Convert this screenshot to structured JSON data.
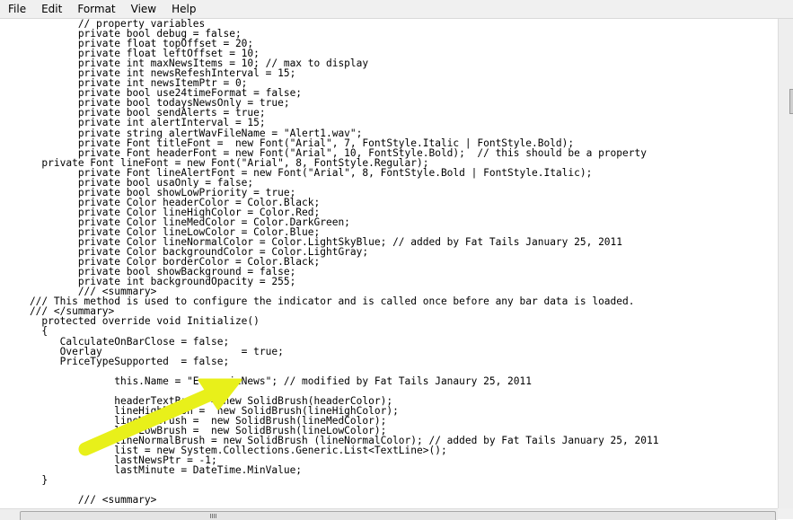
{
  "menu": {
    "items": [
      "File",
      "Edit",
      "Format",
      "View",
      "Help"
    ]
  },
  "editor": {
    "lines": [
      "            // property variables",
      "            private bool debug = false;",
      "            private float topOffset = 20;",
      "            private float leftOffset = 10;",
      "            private int maxNewsItems = 10; // max to display",
      "            private int newsRefeshInterval = 15;",
      "            private int newsItemPtr = 0;",
      "            private bool use24timeFormat = false;",
      "            private bool todaysNewsOnly = true;",
      "            private bool sendAlerts = true;",
      "            private int alertInterval = 15;",
      "            private string alertWavFileName = \"Alert1.wav\";",
      "            private Font titleFont =  new Font(\"Arial\", 7, FontStyle.Italic | FontStyle.Bold);",
      "            private Font headerFont = new Font(\"Arial\", 10, FontStyle.Bold);  // this should be a property",
      "      private Font lineFont = new Font(\"Arial\", 8, FontStyle.Regular);",
      "            private Font lineAlertFont = new Font(\"Arial\", 8, FontStyle.Bold | FontStyle.Italic);",
      "            private bool usaOnly = false;",
      "            private bool showLowPriority = true;",
      "            private Color headerColor = Color.Black;",
      "            private Color lineHighColor = Color.Red;",
      "            private Color lineMedColor = Color.DarkGreen;",
      "            private Color lineLowColor = Color.Blue;",
      "            private Color lineNormalColor = Color.LightSkyBlue; // added by Fat Tails January 25, 2011",
      "            private Color backgroundColor = Color.LightGray;",
      "            private Color borderColor = Color.Black;",
      "            private bool showBackground = false;",
      "            private int backgroundOpacity = 255;",
      "            /// <summary>",
      "    /// This method is used to configure the indicator and is called once before any bar data is loaded.",
      "    /// </summary>",
      "      protected override void Initialize()",
      "      {",
      "         CalculateOnBarClose = false;",
      "         Overlay                       = true;",
      "         PriceTypeSupported  = false;",
      "",
      "                  this.Name = \"EconomicNews\"; // modified by Fat Tails Janaury 25, 2011",
      "",
      "                  headerTextBrush = new SolidBrush(headerColor);",
      "                  lineHighBrush =  new SolidBrush(lineHighColor);",
      "                  lineMedBrush =  new SolidBrush(lineMedColor);",
      "                  lineLowBrush =  new SolidBrush(lineLowColor);",
      "                  lineNormalBrush = new SolidBrush (lineNormalColor); // added by Fat Tails January 25, 2011",
      "                  list = new System.Collections.Generic.List<TextLine>();",
      "                  lastNewsPtr = -1;",
      "                  lastMinute = DateTime.MinValue;",
      "      }",
      "",
      "            /// <summary>"
    ]
  },
  "annotation": {
    "arrow_color": "#e8f01a"
  }
}
